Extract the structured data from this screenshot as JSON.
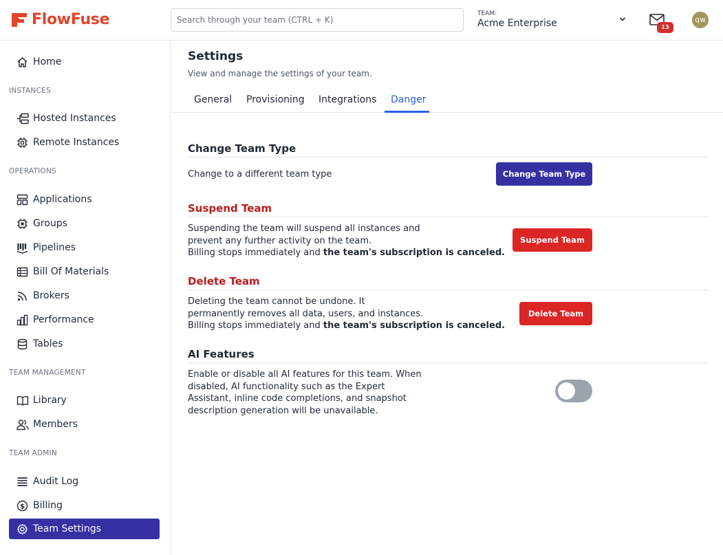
{
  "app": {
    "name": "FlowFuse"
  },
  "header": {
    "search_placeholder": "Search through your team (CTRL + K)",
    "team_label": "TEAM:",
    "team_name": "Acme Enterprise",
    "notification_count": "13",
    "avatar_initials": "qw"
  },
  "sidebar": {
    "home": "Home",
    "sections": [
      {
        "title": "INSTANCES",
        "items": [
          "Hosted Instances",
          "Remote Instances"
        ]
      },
      {
        "title": "OPERATIONS",
        "items": [
          "Applications",
          "Groups",
          "Pipelines",
          "Bill Of Materials",
          "Brokers",
          "Performance",
          "Tables"
        ]
      },
      {
        "title": "TEAM MANAGEMENT",
        "items": [
          "Library",
          "Members"
        ]
      },
      {
        "title": "TEAM ADMIN",
        "items": [
          "Audit Log",
          "Billing",
          "Team Settings"
        ]
      }
    ],
    "active_item": "Team Settings"
  },
  "page": {
    "title": "Settings",
    "subtitle": "View and manage the settings of your team.",
    "tabs": [
      "General",
      "Provisioning",
      "Integrations",
      "Danger"
    ],
    "active_tab": "Danger"
  },
  "danger": {
    "change_type": {
      "heading": "Change Team Type",
      "text": "Change to a different team type",
      "button": "Change Team Type"
    },
    "suspend": {
      "heading": "Suspend Team",
      "line1": "Suspending the team will suspend all instances and",
      "line2": "prevent any further activity on the team.",
      "line3_prefix": "Billing stops immediately and ",
      "line3_bold": "the team's subscription is canceled.",
      "button": "Suspend Team"
    },
    "delete": {
      "heading": "Delete Team",
      "line1": "Deleting the team cannot be undone. It",
      "line2": "permanently removes all data, users, and instances.",
      "line3_prefix": "Billing stops immediately and ",
      "line3_bold": "the team's subscription is canceled.",
      "button": "Delete Team"
    },
    "ai": {
      "heading": "AI Features",
      "line1": "Enable or disable all AI features for this team. When",
      "line2": "disabled, AI functionality such as the Expert",
      "line3": "Assistant, inline code completions, and snapshot",
      "line4": "description generation will be unavailable.",
      "enabled": false
    }
  },
  "colors": {
    "brand": "#e2452b",
    "primary": "#3730a3",
    "danger": "#dc2626",
    "tab_active": "#2563eb"
  }
}
